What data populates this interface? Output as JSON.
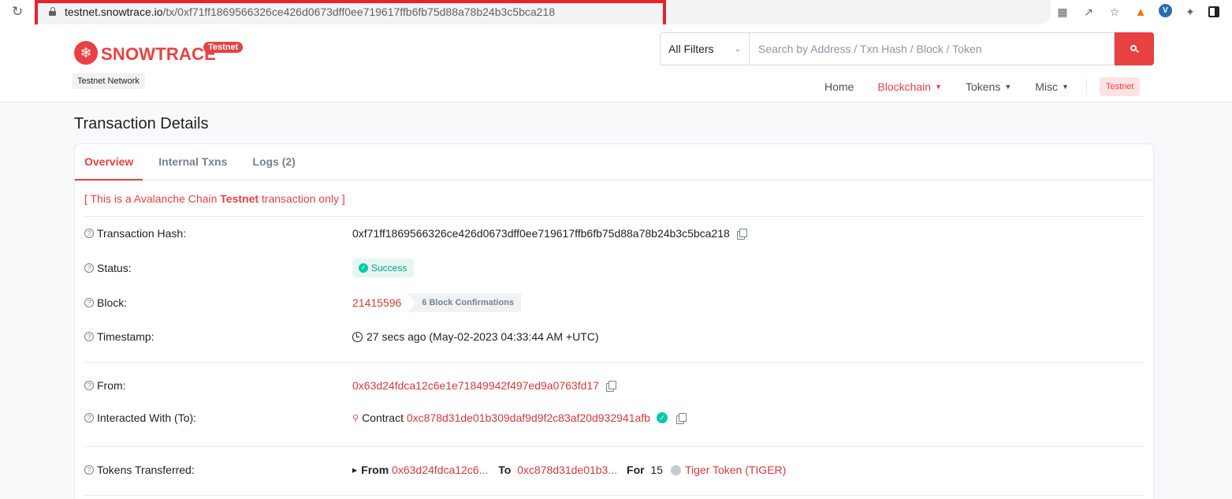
{
  "browser": {
    "url_domain": "testnet.snowtrace.io",
    "url_path": "/tx/0xf71ff1869566326ce426d0673dff0ee719617ffb6fb75d88a78b24b3c5bca218",
    "extensions": [
      "translate-icon",
      "share-icon",
      "star-icon",
      "metamask-fox-icon",
      "vpn-v-icon",
      "puzzle-icon",
      "side-panel-icon"
    ],
    "highlight_color": "#e8222a"
  },
  "header": {
    "logo_text": "SNOWTRACE",
    "logo_badge": "Testnet",
    "network_badge": "Testnet Network",
    "filter_selected": "All Filters",
    "search_placeholder": "Search by Address / Txn Hash / Block / Token",
    "nav": {
      "home": "Home",
      "blockchain": "Blockchain",
      "tokens": "Tokens",
      "misc": "Misc",
      "testnet": "Testnet"
    },
    "accent_color": "#e84142"
  },
  "page": {
    "title": "Transaction Details",
    "tabs": [
      "Overview",
      "Internal Txns",
      "Logs (2)"
    ],
    "notice_prefix": "[ This is a Avalanche Chain ",
    "notice_bold": "Testnet",
    "notice_suffix": " transaction only ]"
  },
  "details": {
    "tx_hash_label": "Transaction Hash:",
    "tx_hash": "0xf71ff1869566326ce426d0673dff0ee719617ffb6fb75d88a78b24b3c5bca218",
    "status_label": "Status:",
    "status": "Success",
    "block_label": "Block:",
    "block": "21415596",
    "confirmations": "6 Block Confirmations",
    "timestamp_label": "Timestamp:",
    "timestamp": "27 secs ago (May-02-2023 04:33:44 AM +UTC)",
    "from_label": "From:",
    "from": "0x63d24fdca12c6e1e71849942f497ed9a0763fd17",
    "to_label": "Interacted With (To):",
    "to_prefix": "Contract",
    "to": "0xc878d31de01b309daf9d9f2c83af20d932941afb",
    "tokens_label": "Tokens Transferred:",
    "tt_from_word": "From",
    "tt_from": "0x63d24fdca12c6...",
    "tt_to_word": "To",
    "tt_to": "0xc878d31de01b3...",
    "tt_for_word": "For",
    "tt_amount": "15",
    "tt_token": "Tiger Token (TIGER)"
  }
}
